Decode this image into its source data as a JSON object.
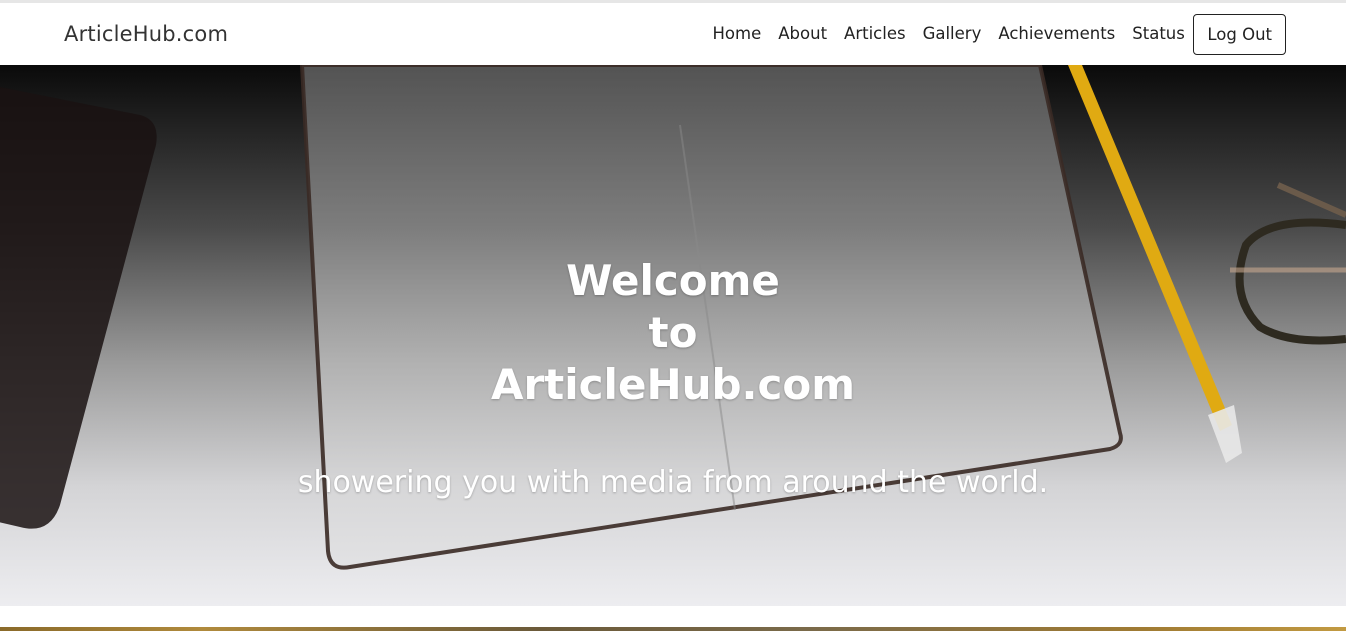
{
  "navbar": {
    "brand": "ArticleHub.com",
    "links": [
      "Home",
      "About",
      "Articles",
      "Gallery",
      "Achievements",
      "Status"
    ],
    "logout_label": "Log Out"
  },
  "hero": {
    "title_lines": [
      "Welcome",
      "to",
      "ArticleHub.com"
    ],
    "subtitle": "showering you with media from around the world."
  },
  "colors": {
    "nav_background": "#ffffff",
    "text_dark": "#222222",
    "hero_text": "#ffffff"
  },
  "icons": [
    "tablet-image",
    "notebook-image",
    "pencil-image",
    "glasses-image"
  ]
}
